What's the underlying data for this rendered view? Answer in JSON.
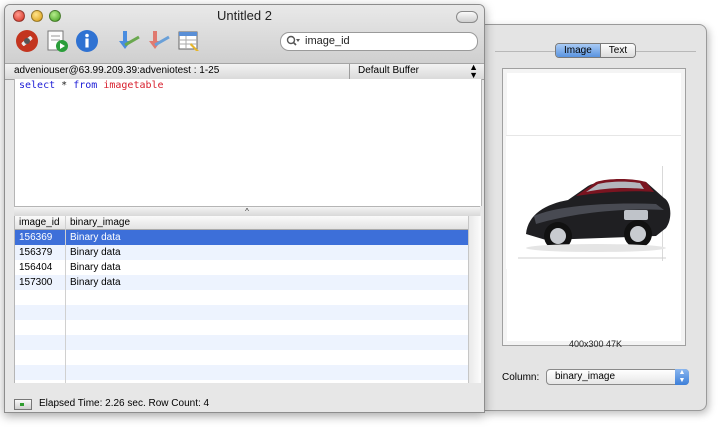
{
  "window": {
    "title": "Untitled 2"
  },
  "toolbar": {
    "buttons": [
      "connect-icon",
      "run-script-icon",
      "info-icon",
      "import-icon",
      "export-icon",
      "table-edit-icon"
    ],
    "search_placeholder": "image_id"
  },
  "connection": {
    "label": "adveniouser@63.99.209.39:adveniotest : 1-25",
    "buffer": "Default Buffer"
  },
  "editor": {
    "kw1": "select",
    "op": "*",
    "kw2": "from",
    "table": "imagetable",
    "colors": {
      "keyword": "#1c1cd6",
      "table": "#d8202e"
    }
  },
  "results": {
    "columns": [
      "image_id",
      "binary_image"
    ],
    "rows": [
      {
        "image_id": "156369",
        "binary_image": "Binary data",
        "selected": true
      },
      {
        "image_id": "156379",
        "binary_image": "Binary data"
      },
      {
        "image_id": "156404",
        "binary_image": "Binary data"
      },
      {
        "image_id": "157300",
        "binary_image": "Binary data"
      }
    ],
    "selection_color": "#3d6fd9"
  },
  "status": {
    "text": "Elapsed Time: 2.26 sec. Row Count: 4"
  },
  "drawer": {
    "tabs": [
      "Image",
      "Text"
    ],
    "active_tab": "Image",
    "image_caption": "400x300 47K",
    "column_label": "Column:",
    "column_value": "binary_image"
  }
}
